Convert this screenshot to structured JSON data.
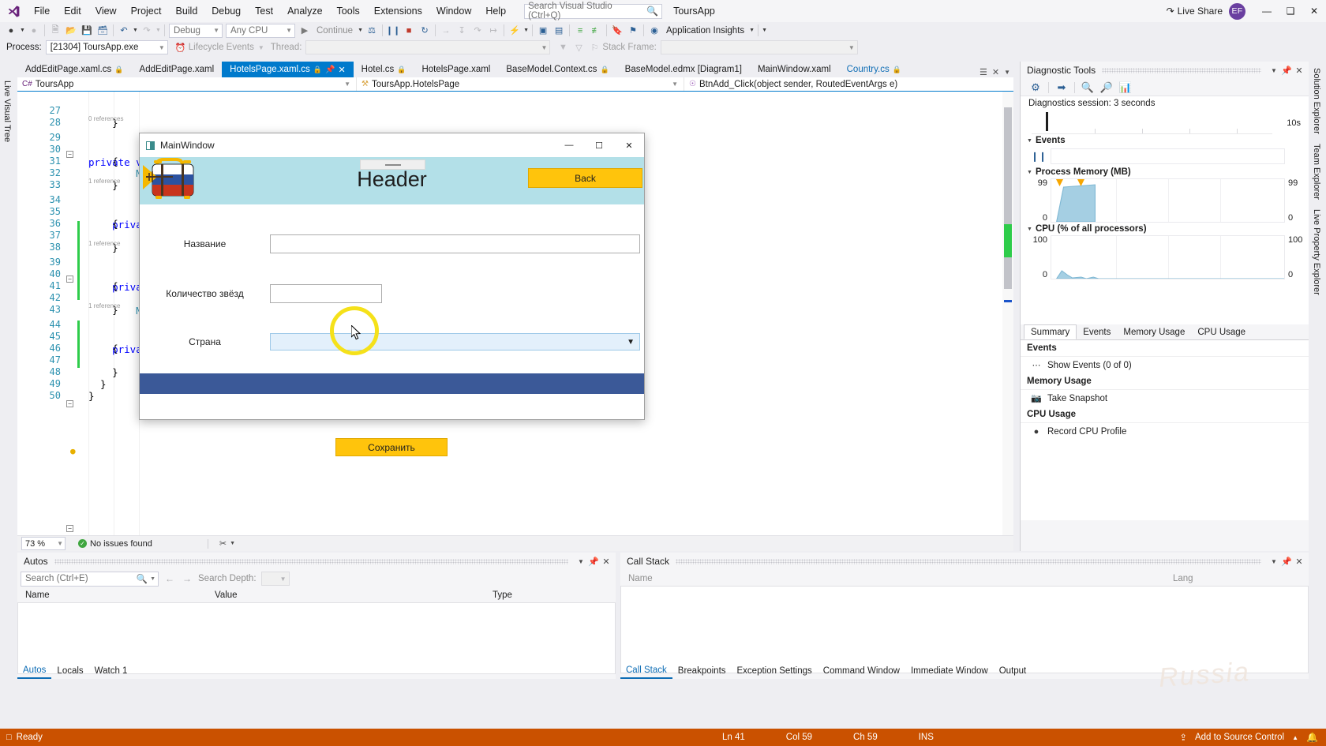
{
  "menu": {
    "items": [
      "File",
      "Edit",
      "View",
      "Project",
      "Build",
      "Debug",
      "Test",
      "Analyze",
      "Tools",
      "Extensions",
      "Window",
      "Help"
    ],
    "search_placeholder": "Search Visual Studio (Ctrl+Q)",
    "project_name": "ToursApp",
    "live_share": "Live Share",
    "account_initials": "EF",
    "minimize": "—",
    "maximize": "❑",
    "close": "✕"
  },
  "toolbar": {
    "config": "Debug",
    "platform": "Any CPU",
    "continue": "Continue",
    "lifecycle_events": "Lifecycle Events",
    "app_insights": "Application Insights"
  },
  "process_bar": {
    "process_label": "Process:",
    "process_value": "[21304] ToursApp.exe",
    "thread_label": "Thread:",
    "thread_value": "",
    "stack_frame_label": "Stack Frame:",
    "stack_frame_value": ""
  },
  "left_rail": [
    "Live Visual Tree"
  ],
  "right_rail": [
    "Solution Explorer",
    "Team Explorer",
    "Live Property Explorer"
  ],
  "doc_tabs": [
    {
      "label": "AddEditPage.xaml.cs",
      "locked": true,
      "active": false
    },
    {
      "label": "AddEditPage.xaml",
      "locked": false,
      "active": false
    },
    {
      "label": "HotelsPage.xaml.cs",
      "locked": true,
      "active": true
    },
    {
      "label": "Hotel.cs",
      "locked": true,
      "active": false
    },
    {
      "label": "HotelsPage.xaml",
      "locked": false,
      "active": false
    },
    {
      "label": "BaseModel.Context.cs",
      "locked": true,
      "active": false
    },
    {
      "label": "BaseModel.edmx [Diagram1]",
      "locked": false,
      "active": false
    },
    {
      "label": "MainWindow.xaml",
      "locked": false,
      "active": false
    },
    {
      "label": "Country.cs",
      "locked": true,
      "active": false
    }
  ],
  "nav_bar": {
    "project": "ToursApp",
    "class": "ToursApp.HotelsPage",
    "member": "BtnAdd_Click(object sender, RoutedEventArgs e)"
  },
  "code": {
    "lines": [
      {
        "n": "27",
        "text": "    }"
      },
      {
        "n": "28",
        "text": ""
      },
      {
        "n": "29",
        "text": "    private void Button_Click(object sender, RoutedEventArgs e)",
        "ref": "0 references",
        "fold": true
      },
      {
        "n": "30",
        "text": "    {"
      },
      {
        "n": "31",
        "text": "        M"
      },
      {
        "n": "32",
        "text": "    }"
      },
      {
        "n": "33",
        "text": ""
      },
      {
        "n": "34",
        "text": "    priva",
        "ref": "1 reference",
        "fold": true
      },
      {
        "n": "35",
        "text": "    {"
      },
      {
        "n": "36",
        "text": ""
      },
      {
        "n": "37",
        "text": "    }"
      },
      {
        "n": "38",
        "text": ""
      },
      {
        "n": "39",
        "text": "    priva",
        "ref": "1 reference",
        "fold": true
      },
      {
        "n": "40",
        "text": "    {"
      },
      {
        "n": "41",
        "text": "        M",
        "bulb": true
      },
      {
        "n": "42",
        "text": "    }"
      },
      {
        "n": "43",
        "text": ""
      },
      {
        "n": "44",
        "text": "    priva",
        "ref": "1 reference",
        "fold": true
      },
      {
        "n": "45",
        "text": "    {"
      },
      {
        "n": "46",
        "text": ""
      },
      {
        "n": "47",
        "text": "    }"
      },
      {
        "n": "48",
        "text": "  }"
      },
      {
        "n": "49",
        "text": "}"
      },
      {
        "n": "50",
        "text": ""
      }
    ]
  },
  "editor_status": {
    "zoom": "73 %",
    "issues": "No issues found",
    "issue_mark": "✓"
  },
  "diagnostics": {
    "title": "Diagnostic Tools",
    "session": "Diagnostics session: 3 seconds",
    "timeline_label": "10s",
    "events_title": "Events",
    "memory_title": "Process Memory (MB)",
    "memory_max": "99",
    "memory_min": "0",
    "memory_right_max": "99",
    "memory_right_min": "0",
    "cpu_title": "CPU (% of all processors)",
    "cpu_max": "100",
    "cpu_min": "0",
    "cpu_right_max": "100",
    "cpu_right_min": "0",
    "tabs": [
      {
        "label": "Summary",
        "active": true
      },
      {
        "label": "Events",
        "active": false
      },
      {
        "label": "Memory Usage",
        "active": false
      },
      {
        "label": "CPU Usage",
        "active": false
      }
    ],
    "summary": [
      {
        "type": "header",
        "label": "Events"
      },
      {
        "type": "item",
        "label": "Show Events (0 of 0)",
        "icon": "events-icon"
      },
      {
        "type": "header",
        "label": "Memory Usage"
      },
      {
        "type": "item",
        "label": "Take Snapshot",
        "icon": "camera-icon"
      },
      {
        "type": "header",
        "label": "CPU Usage"
      },
      {
        "type": "item",
        "label": "Record CPU Profile",
        "icon": "record-icon"
      }
    ]
  },
  "autos": {
    "title": "Autos",
    "search_placeholder": "Search (Ctrl+E)",
    "search_depth_label": "Search Depth:",
    "search_depth_value": "",
    "columns": [
      "Name",
      "Value",
      "Type"
    ],
    "rows": [],
    "tabs": [
      {
        "label": "Autos",
        "active": true
      },
      {
        "label": "Locals",
        "active": false
      },
      {
        "label": "Watch 1",
        "active": false
      }
    ]
  },
  "call_stack": {
    "title": "Call Stack",
    "columns": [
      "Name",
      "Lang"
    ],
    "rows": [],
    "tabs": [
      {
        "label": "Call Stack",
        "active": true
      },
      {
        "label": "Breakpoints",
        "active": false
      },
      {
        "label": "Exception Settings",
        "active": false
      },
      {
        "label": "Command Window",
        "active": false
      },
      {
        "label": "Immediate Window",
        "active": false
      },
      {
        "label": "Output",
        "active": false
      }
    ]
  },
  "status_bar": {
    "ready": "Ready",
    "line": "Ln 41",
    "col": "Col 59",
    "ch": "Ch 59",
    "ins": "INS",
    "source_control": "Add to Source Control",
    "bell": "🔔"
  },
  "app_window": {
    "title": "MainWindow",
    "minimize": "—",
    "maximize": "☐",
    "close": "✕",
    "header_text": "Header",
    "back_button": "Back",
    "save_button": "Сохранить",
    "fields": [
      {
        "label": "Название",
        "value": "",
        "kind": "text"
      },
      {
        "label": "Количество звёзд",
        "value": "",
        "kind": "text"
      },
      {
        "label": "Страна",
        "value": "",
        "kind": "combo"
      }
    ],
    "colors": {
      "header_bg": "#b3e0e8",
      "accent_yellow": "#ffc40c",
      "footer_bg": "#3b5998",
      "combo_bg": "#e3f0fb"
    }
  },
  "watermark": "Russia"
}
